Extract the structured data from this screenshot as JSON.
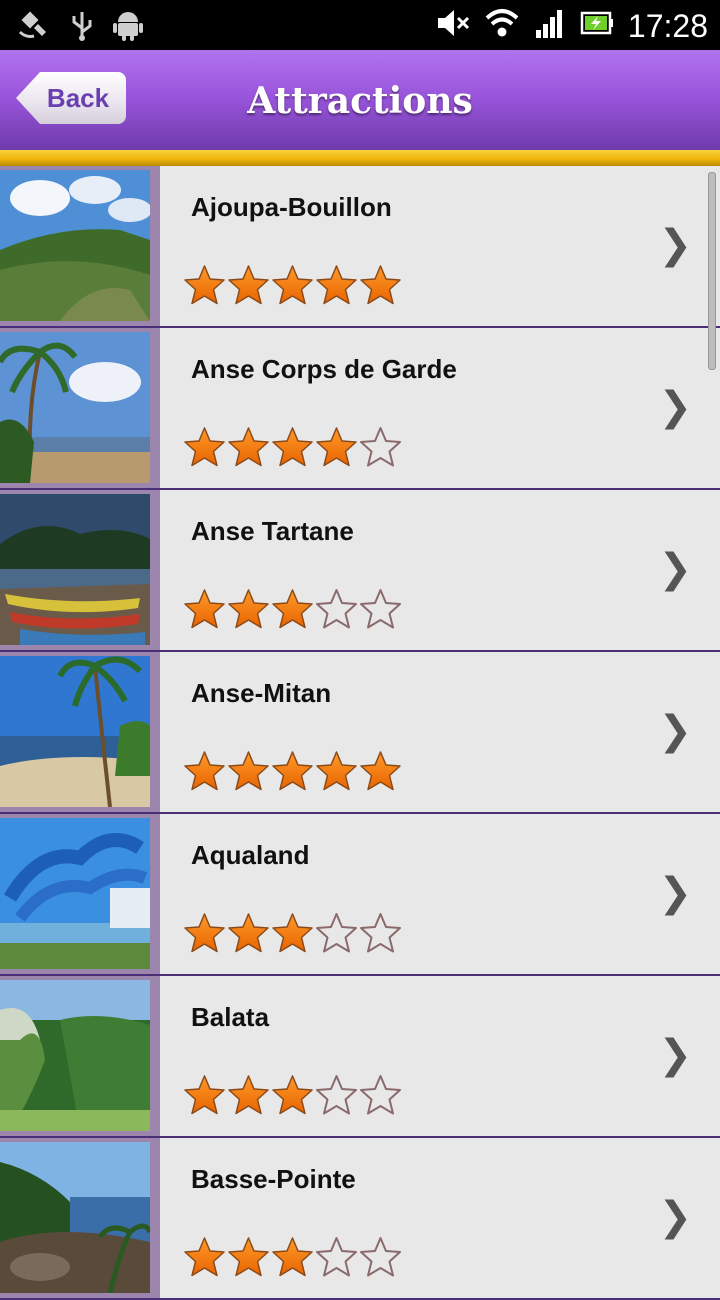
{
  "status_bar": {
    "time": "17:28",
    "left_icons": [
      "satellite-icon",
      "usb-icon",
      "android-icon"
    ],
    "right_icons": [
      "mute-icon",
      "wifi-icon",
      "signal-icon",
      "battery-icon"
    ]
  },
  "header": {
    "back_label": "Back",
    "title": "Attractions",
    "accent_color": "#9a56dc",
    "underline_color": "#f0b70d"
  },
  "attractions": [
    {
      "name": "Ajoupa-Bouillon",
      "rating": 5
    },
    {
      "name": "Anse Corps de Garde",
      "rating": 4
    },
    {
      "name": "Anse Tartane",
      "rating": 3
    },
    {
      "name": "Anse-Mitan",
      "rating": 5
    },
    {
      "name": "Aqualand",
      "rating": 3
    },
    {
      "name": "Balata",
      "rating": 3
    },
    {
      "name": "Basse-Pointe",
      "rating": 3
    }
  ],
  "icons": {
    "chevron": "chevron-right-icon",
    "star_filled": "star-filled-icon",
    "star_empty": "star-empty-icon"
  },
  "list_scroll_position": 0
}
